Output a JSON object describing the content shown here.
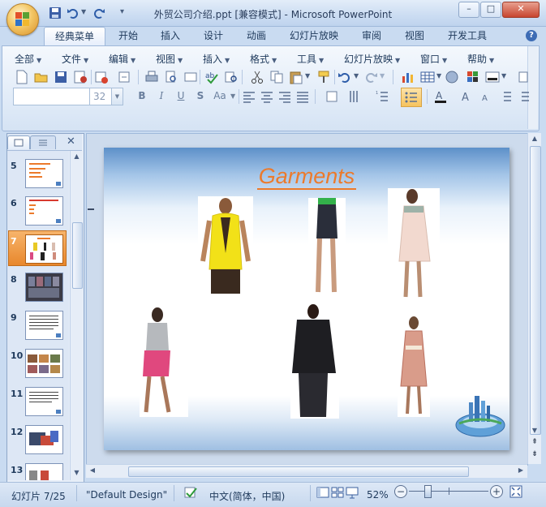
{
  "window": {
    "title": "外贸公司介绍.ppt [兼容模式] - Microsoft PowerPoint",
    "minimize": "–",
    "maximize": "□",
    "close": "✕"
  },
  "ribbon_tabs": [
    "经典菜单",
    "开始",
    "插入",
    "设计",
    "动画",
    "幻灯片放映",
    "审阅",
    "视图",
    "开发工具"
  ],
  "menu": [
    "全部",
    "文件",
    "编辑",
    "视图",
    "插入",
    "格式",
    "工具",
    "幻灯片放映",
    "窗口",
    "帮助"
  ],
  "format_bar": {
    "font_name": "",
    "font_size": "32",
    "bold": "B",
    "italic": "I",
    "underline": "U",
    "shadow": "S",
    "case": "Aa"
  },
  "help_label": "?",
  "panel": {
    "close_label": "✕",
    "slide_numbers": [
      "5",
      "6",
      "7",
      "8",
      "9",
      "10",
      "11",
      "12",
      "13"
    ],
    "selected": "7"
  },
  "slide": {
    "title": "Garments"
  },
  "status": {
    "slide_info": "幻灯片 7/25",
    "theme": "\"Default Design\"",
    "language": "中文(简体，中国)",
    "zoom": "52%",
    "zoom_minus": "−",
    "zoom_plus": "+"
  },
  "colors": {
    "accent_orange": "#ec7a2b",
    "selected_thumb": "#e8872c",
    "window_blue": "#c9dbf1"
  },
  "icons": [
    "office-logo-icon",
    "save-icon",
    "undo-icon",
    "redo-icon",
    "customize-icon",
    "new-icon",
    "open-icon",
    "print-icon",
    "cut-icon",
    "copy-icon",
    "paste-icon",
    "format-painter-icon",
    "chart-icon",
    "table-icon",
    "spell-check-icon",
    "fit-window-icon",
    "normal-view-icon",
    "sorter-view-icon",
    "slideshow-icon",
    "language-check-icon"
  ]
}
